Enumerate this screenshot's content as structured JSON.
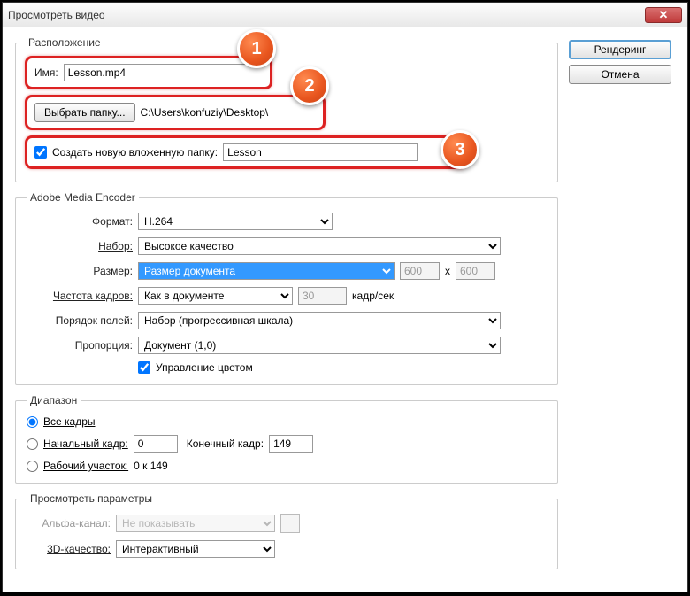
{
  "window": {
    "title": "Просмотреть видео"
  },
  "buttons": {
    "render": "Рендеринг",
    "cancel": "Отмена"
  },
  "location": {
    "legend": "Расположение",
    "name_label": "Имя:",
    "name_value": "Lesson.mp4",
    "choose_folder": "Выбрать папку...",
    "path": "C:\\Users\\konfuziy\\Desktop\\",
    "subfolder_label": "Создать новую вложенную папку:",
    "subfolder_value": "Lesson"
  },
  "badges": {
    "b1": "1",
    "b2": "2",
    "b3": "3"
  },
  "encoder": {
    "legend": "Adobe Media Encoder",
    "format_label": "Формат:",
    "format_value": "H.264",
    "preset_label": "Набор:",
    "preset_value": "Высокое качество",
    "size_label": "Размер:",
    "size_value": "Размер документа",
    "width": "600",
    "x": "x",
    "height": "600",
    "fps_label": "Частота кадров:",
    "fps_mode": "Как в документе",
    "fps_value": "30",
    "fps_unit": "кадр/сек",
    "fieldorder_label": "Порядок полей:",
    "fieldorder_value": "Набор (прогрессивная шкала)",
    "aspect_label": "Пропорция:",
    "aspect_value": "Документ (1,0)",
    "color_mgmt": "Управление цветом"
  },
  "range": {
    "legend": "Диапазон",
    "all_frames": "Все кадры",
    "start_label": "Начальный кадр:",
    "start_value": "0",
    "end_label": "Конечный кадр:",
    "end_value": "149",
    "workarea_label": "Рабочий участок:",
    "workarea_value": "0 к 149"
  },
  "preview": {
    "legend": "Просмотреть параметры",
    "alpha_label": "Альфа-канал:",
    "alpha_value": "Не показывать",
    "quality_label": "3D-качество:",
    "quality_value": "Интерактивный"
  }
}
